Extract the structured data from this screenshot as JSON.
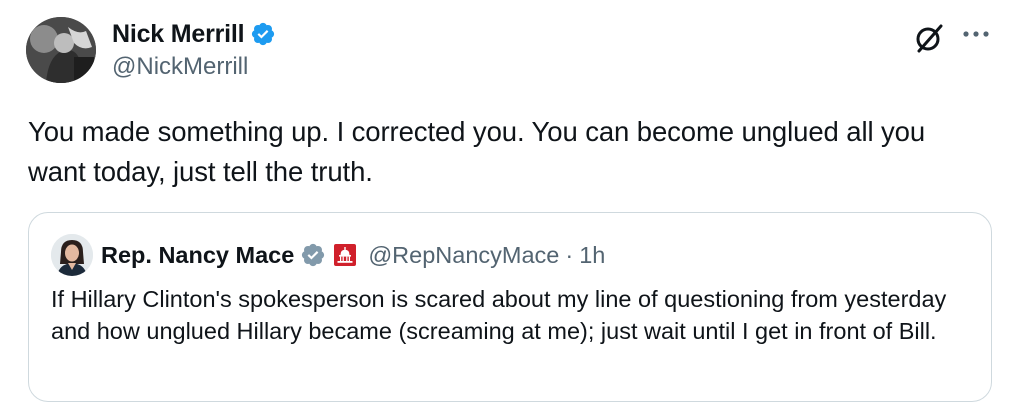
{
  "tweet": {
    "author": {
      "name": "Nick Merrill",
      "handle": "@NickMerrill",
      "verified": true
    },
    "text": "You made something up. I corrected you. You can become unglued all you want today, just tell the truth.",
    "actions": {
      "grok_icon": "grok-icon",
      "more_icon": "more-icon"
    }
  },
  "quote": {
    "author": {
      "name": "Rep. Nancy Mace",
      "handle": "@RepNancyMace",
      "verified": true,
      "affiliation_icon": "us-capitol-icon"
    },
    "separator": "·",
    "time": "1h",
    "text": "If Hillary Clinton's spokesperson is scared about my line of questioning from yesterday and how unglued Hillary became (screaming at me); just wait until I get in front of Bill."
  },
  "colors": {
    "verified_blue": "#1d9bf0",
    "verified_gray": "#829aab",
    "gov_red": "#d0202b",
    "secondary_text": "#536471",
    "border": "#cfd9de"
  }
}
